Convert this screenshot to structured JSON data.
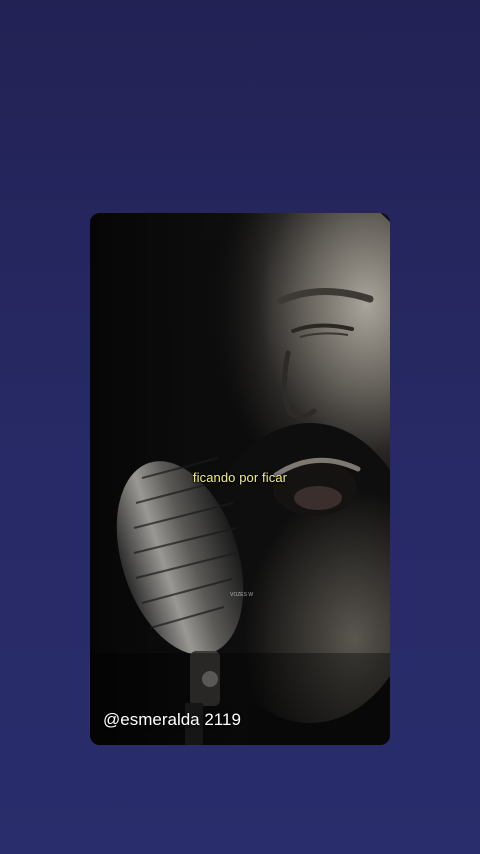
{
  "video": {
    "subtitle": "ficando por ficar",
    "watermark": "VOZES W",
    "username": "@esmeralda 2119"
  },
  "colors": {
    "background_top": "#232255",
    "background_bottom": "#292d6b",
    "subtitle": "#f2f07a"
  }
}
